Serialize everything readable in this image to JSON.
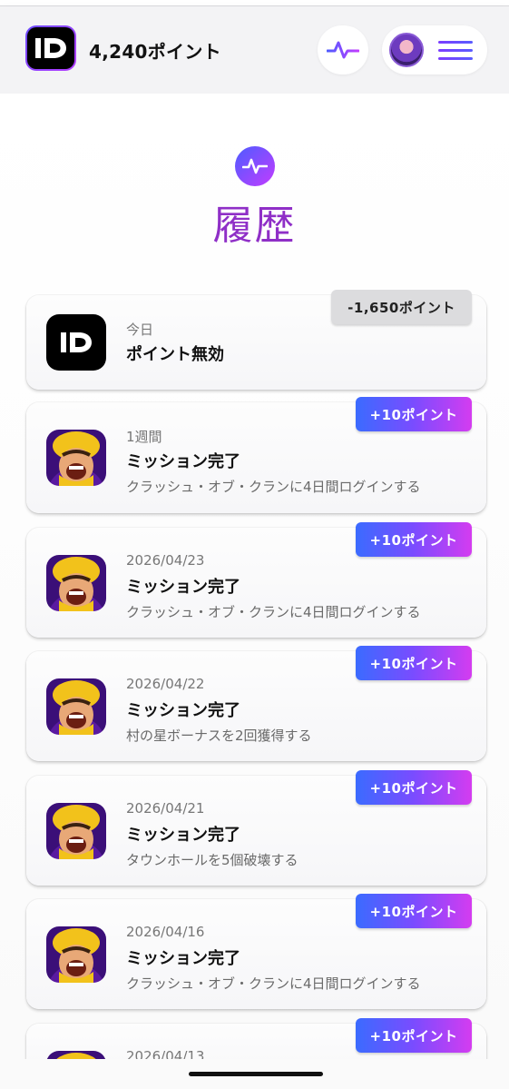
{
  "header": {
    "logo_text": "ID",
    "points": "4,240ポイント",
    "pulse_icon": "activity-pulse-icon",
    "avatar_icon": "user-avatar",
    "menu_icon": "hamburger-menu-icon"
  },
  "page": {
    "title": "履歴",
    "title_icon": "activity-pulse-icon"
  },
  "history": [
    {
      "date": "今日",
      "title": "ポイント無効",
      "subtitle": "",
      "points": "-1,650ポイント",
      "kind": "minus",
      "icon": "id-logo"
    },
    {
      "date": "1週間",
      "title": "ミッション完了",
      "subtitle": "クラッシュ・オブ・クランに4日間ログインする",
      "points": "+10ポイント",
      "kind": "plus",
      "icon": "clash-of-clans-icon"
    },
    {
      "date": "2026/04/23",
      "title": "ミッション完了",
      "subtitle": "クラッシュ・オブ・クランに4日間ログインする",
      "points": "+10ポイント",
      "kind": "plus",
      "icon": "clash-of-clans-icon"
    },
    {
      "date": "2026/04/22",
      "title": "ミッション完了",
      "subtitle": "村の星ボーナスを2回獲得する",
      "points": "+10ポイント",
      "kind": "plus",
      "icon": "clash-of-clans-icon"
    },
    {
      "date": "2026/04/21",
      "title": "ミッション完了",
      "subtitle": "タウンホールを5個破壊する",
      "points": "+10ポイント",
      "kind": "plus",
      "icon": "clash-of-clans-icon"
    },
    {
      "date": "2026/04/16",
      "title": "ミッション完了",
      "subtitle": "クラッシュ・オブ・クランに4日間ログインする",
      "points": "+10ポイント",
      "kind": "plus",
      "icon": "clash-of-clans-icon"
    },
    {
      "date": "2026/04/13",
      "title": "",
      "subtitle": "",
      "points": "+10ポイント",
      "kind": "plus",
      "icon": "clash-of-clans-icon"
    }
  ],
  "colors": {
    "accent_purple": "#8f2fc7",
    "badge_gradient_start": "#3b6bff",
    "badge_gradient_end": "#d43cf0",
    "negative_badge": "#dcdcde"
  }
}
